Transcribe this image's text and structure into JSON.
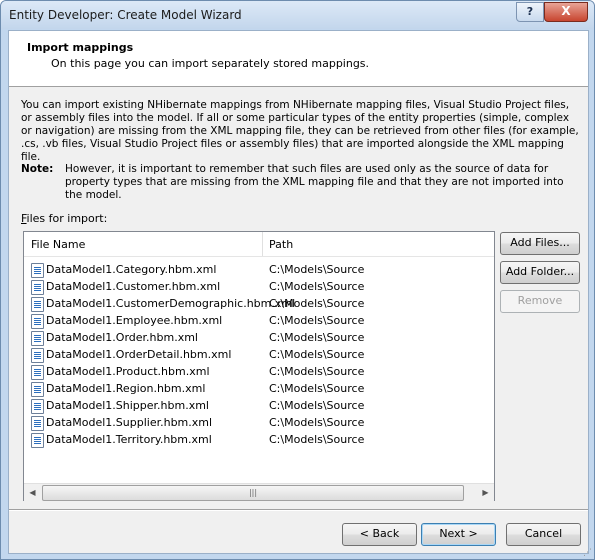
{
  "window": {
    "title": "Entity Developer: Create Model Wizard",
    "help_label": "?",
    "close_label": "X"
  },
  "header": {
    "title": "Import mappings",
    "description": "On this page you can import separately stored mappings."
  },
  "intro": "You can import existing NHibernate mappings from NHibernate mapping files, Visual Studio Project files, or assembly files into the model. If all or some particular types of the entity properties (simple, complex or navigation) are missing from the XML mapping file, they can be retrieved from other files (for example, .cs, .vb files, Visual Studio Project files or assembly files) that are imported alongside the XML mapping file.",
  "note": {
    "label": "Note:",
    "text": "However, it is important to remember that such files are used only as the source of data for property types that are missing from the XML mapping file and that they are not imported into the model."
  },
  "files_label": {
    "first": "F",
    "rest": "iles for import:"
  },
  "list": {
    "columns": [
      "File Name",
      "Path"
    ],
    "rows": [
      {
        "name": "DataModel1.Category.hbm.xml",
        "path": "C:\\Models\\Source"
      },
      {
        "name": "DataModel1.Customer.hbm.xml",
        "path": "C:\\Models\\Source"
      },
      {
        "name": "DataModel1.CustomerDemographic.hbm.xml",
        "path": "C:\\Models\\Source"
      },
      {
        "name": "DataModel1.Employee.hbm.xml",
        "path": "C:\\Models\\Source"
      },
      {
        "name": "DataModel1.Order.hbm.xml",
        "path": "C:\\Models\\Source"
      },
      {
        "name": "DataModel1.OrderDetail.hbm.xml",
        "path": "C:\\Models\\Source"
      },
      {
        "name": "DataModel1.Product.hbm.xml",
        "path": "C:\\Models\\Source"
      },
      {
        "name": "DataModel1.Region.hbm.xml",
        "path": "C:\\Models\\Source"
      },
      {
        "name": "DataModel1.Shipper.hbm.xml",
        "path": "C:\\Models\\Source"
      },
      {
        "name": "DataModel1.Supplier.hbm.xml",
        "path": "C:\\Models\\Source"
      },
      {
        "name": "DataModel1.Territory.hbm.xml",
        "path": "C:\\Models\\Source"
      }
    ]
  },
  "side_buttons": {
    "add_files": "Add Files...",
    "add_folder": "Add Folder...",
    "remove": "Remove"
  },
  "nav_buttons": {
    "back": "< Back",
    "next": "Next >",
    "cancel": "Cancel"
  }
}
